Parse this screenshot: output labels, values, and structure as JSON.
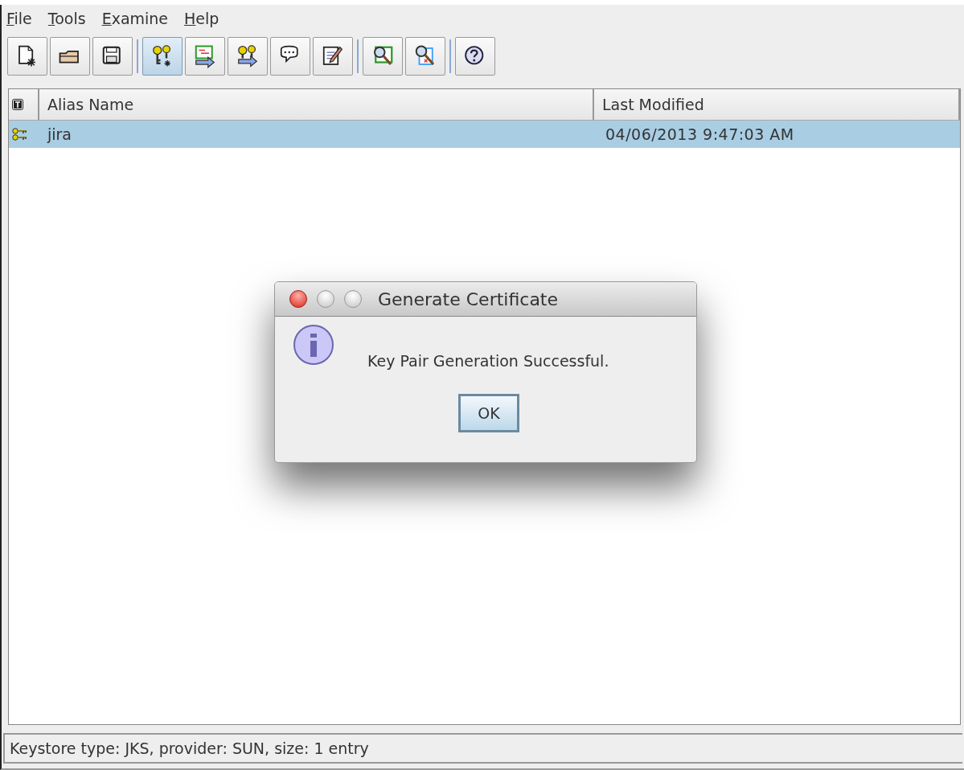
{
  "menu": [
    {
      "label": "File"
    },
    {
      "label": "Tools"
    },
    {
      "label": "Examine"
    },
    {
      "label": "Help"
    }
  ],
  "toolbar": [
    {
      "kind": "new",
      "pressed": false
    },
    {
      "kind": "open",
      "pressed": false
    },
    {
      "kind": "save",
      "pressed": false
    },
    {
      "kind": "separator"
    },
    {
      "kind": "keypair",
      "pressed": true
    },
    {
      "kind": "import-cert",
      "pressed": false
    },
    {
      "kind": "import-keypair",
      "pressed": false
    },
    {
      "kind": "comment",
      "pressed": false
    },
    {
      "kind": "edit",
      "pressed": false
    },
    {
      "kind": "separator"
    },
    {
      "kind": "examine-cert",
      "pressed": false
    },
    {
      "kind": "examine-file",
      "pressed": false
    },
    {
      "kind": "separator"
    },
    {
      "kind": "help",
      "pressed": false
    }
  ],
  "table": {
    "columns": [
      "Alias Name",
      "Last Modified"
    ],
    "rows": [
      {
        "kind": "keypair",
        "alias": "jira",
        "modified": "04/06/2013 9:47:03 AM",
        "selected": true
      }
    ]
  },
  "dialog": {
    "title": "Generate Certificate",
    "message": "Key Pair Generation Successful.",
    "button": "OK"
  },
  "status_bar": "Keystore type: JKS, provider: SUN, size: 1 entry"
}
